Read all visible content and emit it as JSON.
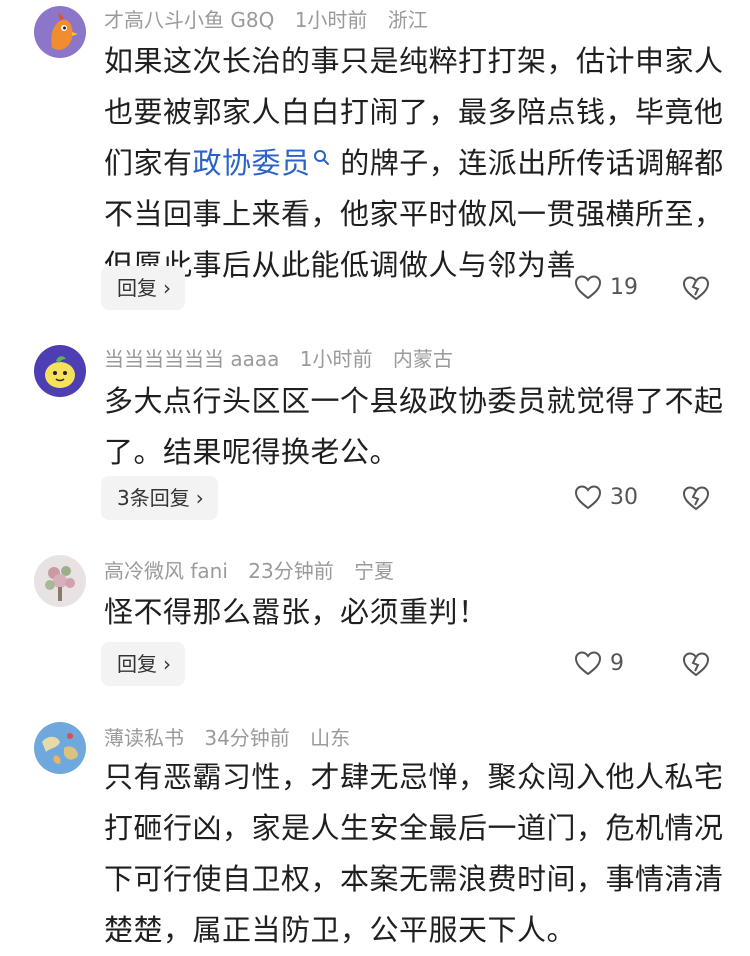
{
  "comments": [
    {
      "username": "才高八斗小鱼 G8Q",
      "time": "1小时前",
      "location": "浙江",
      "lines": [
        "如果这次长治的事只是纯粹打打架，估计申家人",
        "也要被郭家人白白打闹了，最多陪点钱，毕竟他",
        "们家有",
        "不当回事上来看，他家平时做风一贯强横所至，",
        "但愿此事后从此能低调做人与邻为善"
      ],
      "link_text": "政协委员",
      "line3_tail": "的牌子，连派出所传话调解都",
      "reply_label": "回复",
      "likes": "19"
    },
    {
      "username": "当当当当当当 aaaa",
      "time": "1小时前",
      "location": "内蒙古",
      "lines": [
        "多大点行头区区一个县级政协委员就觉得了不起",
        "了。结果呢得换老公。"
      ],
      "reply_label": "3条回复",
      "likes": "30"
    },
    {
      "username": "高冷微风 fani",
      "time": "23分钟前",
      "location": "宁夏",
      "lines": [
        "怪不得那么嚣张，必须重判！"
      ],
      "reply_label": "回复",
      "likes": "9"
    },
    {
      "username": "薄读私书",
      "time": "34分钟前",
      "location": "山东",
      "lines": [
        "只有恶霸习性，才肆无忌惮，聚众闯入他人私宅",
        "打砸行凶，家是人生安全最后一道门，危机情况",
        "下可行使自卫权，本案无需浪费时间，事情清清",
        "楚楚，属正当防卫，公平服天下人。"
      ]
    }
  ],
  "icons": {
    "like": "heart-outline-icon",
    "dislike": "broken-heart-icon",
    "search": "search-icon",
    "chevron": "chevron-right-icon"
  },
  "colors": {
    "link": "#2b62c8",
    "meta": "#9a9a9a",
    "reply_bg": "#f3f3f3"
  }
}
